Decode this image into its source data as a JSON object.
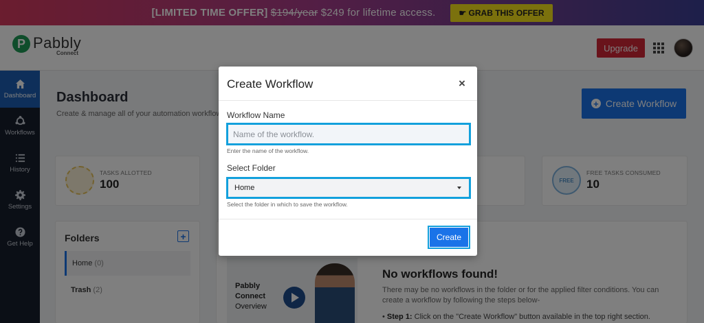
{
  "promo": {
    "prefix": "[LIMITED TIME OFFER]",
    "old_price": "$194/year",
    "offer": "$249 for lifetime access.",
    "button": "☛ GRAB THIS OFFER"
  },
  "header": {
    "logo_name": "Pabbly",
    "logo_sub": "Connect",
    "upgrade_label": "Upgrade"
  },
  "sidebar": {
    "items": [
      {
        "label": "Dashboard",
        "icon": "home-icon"
      },
      {
        "label": "Workflows",
        "icon": "workflows-icon"
      },
      {
        "label": "History",
        "icon": "history-icon"
      },
      {
        "label": "Settings",
        "icon": "gear-icon"
      },
      {
        "label": "Get Help",
        "icon": "help-icon"
      }
    ]
  },
  "dashboard": {
    "title": "Dashboard",
    "subtitle": "Create & manage all of your automation workflows",
    "create_button": "Create Workflow"
  },
  "stats": {
    "tasks_allotted_label": "TASKS ALLOTTED",
    "tasks_allotted_value": "100",
    "free_tasks_label": "FREE TASKS CONSUMED",
    "free_tasks_value": "10",
    "free_badge": "FREE"
  },
  "folders": {
    "title": "Folders",
    "items": [
      {
        "name": "Home",
        "count": "(0)"
      },
      {
        "name": "Trash",
        "count": "(2)"
      }
    ]
  },
  "video": {
    "line1": "Pabbly",
    "line2": "Connect",
    "line3": "Overview"
  },
  "empty_state": {
    "title": "No workflows found!",
    "description": "There may be no workflows in the folder or for the applied filter conditions. You can create a workflow by following the steps below-",
    "step_label": "Step 1:",
    "step_text": "Click on the \"Create Workflow\" button available in the top right section."
  },
  "modal": {
    "title": "Create Workflow",
    "close": "×",
    "name_label": "Workflow Name",
    "name_placeholder": "Name of the workflow.",
    "name_value": "",
    "name_help": "Enter the name of the workflow.",
    "folder_label": "Select Folder",
    "folder_value": "Home",
    "folder_help": "Select the folder in which to save the workflow.",
    "create_button": "Create"
  },
  "colors": {
    "accent": "#1a73e8",
    "focus_ring": "#12a0dc",
    "sidebar_bg": "#171e2c",
    "sidebar_active": "#1d5fb4",
    "upgrade": "#d32636",
    "promo_button": "#f7e21a",
    "brand_green": "#1e9b56"
  }
}
